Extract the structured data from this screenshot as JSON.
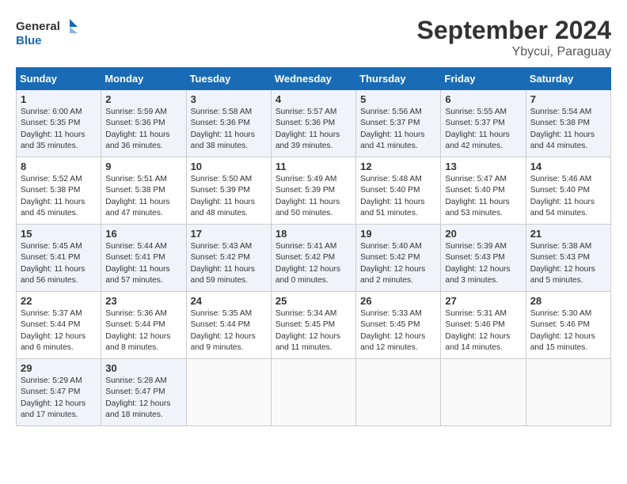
{
  "logo": {
    "line1": "General",
    "line2": "Blue"
  },
  "title": "September 2024",
  "subtitle": "Ybycui, Paraguay",
  "headers": [
    "Sunday",
    "Monday",
    "Tuesday",
    "Wednesday",
    "Thursday",
    "Friday",
    "Saturday"
  ],
  "weeks": [
    [
      {
        "num": "1",
        "info": "Sunrise: 6:00 AM\nSunset: 5:35 PM\nDaylight: 11 hours\nand 35 minutes."
      },
      {
        "num": "2",
        "info": "Sunrise: 5:59 AM\nSunset: 5:36 PM\nDaylight: 11 hours\nand 36 minutes."
      },
      {
        "num": "3",
        "info": "Sunrise: 5:58 AM\nSunset: 5:36 PM\nDaylight: 11 hours\nand 38 minutes."
      },
      {
        "num": "4",
        "info": "Sunrise: 5:57 AM\nSunset: 5:36 PM\nDaylight: 11 hours\nand 39 minutes."
      },
      {
        "num": "5",
        "info": "Sunrise: 5:56 AM\nSunset: 5:37 PM\nDaylight: 11 hours\nand 41 minutes."
      },
      {
        "num": "6",
        "info": "Sunrise: 5:55 AM\nSunset: 5:37 PM\nDaylight: 11 hours\nand 42 minutes."
      },
      {
        "num": "7",
        "info": "Sunrise: 5:54 AM\nSunset: 5:38 PM\nDaylight: 11 hours\nand 44 minutes."
      }
    ],
    [
      {
        "num": "8",
        "info": "Sunrise: 5:52 AM\nSunset: 5:38 PM\nDaylight: 11 hours\nand 45 minutes."
      },
      {
        "num": "9",
        "info": "Sunrise: 5:51 AM\nSunset: 5:38 PM\nDaylight: 11 hours\nand 47 minutes."
      },
      {
        "num": "10",
        "info": "Sunrise: 5:50 AM\nSunset: 5:39 PM\nDaylight: 11 hours\nand 48 minutes."
      },
      {
        "num": "11",
        "info": "Sunrise: 5:49 AM\nSunset: 5:39 PM\nDaylight: 11 hours\nand 50 minutes."
      },
      {
        "num": "12",
        "info": "Sunrise: 5:48 AM\nSunset: 5:40 PM\nDaylight: 11 hours\nand 51 minutes."
      },
      {
        "num": "13",
        "info": "Sunrise: 5:47 AM\nSunset: 5:40 PM\nDaylight: 11 hours\nand 53 minutes."
      },
      {
        "num": "14",
        "info": "Sunrise: 5:46 AM\nSunset: 5:40 PM\nDaylight: 11 hours\nand 54 minutes."
      }
    ],
    [
      {
        "num": "15",
        "info": "Sunrise: 5:45 AM\nSunset: 5:41 PM\nDaylight: 11 hours\nand 56 minutes."
      },
      {
        "num": "16",
        "info": "Sunrise: 5:44 AM\nSunset: 5:41 PM\nDaylight: 11 hours\nand 57 minutes."
      },
      {
        "num": "17",
        "info": "Sunrise: 5:43 AM\nSunset: 5:42 PM\nDaylight: 11 hours\nand 59 minutes."
      },
      {
        "num": "18",
        "info": "Sunrise: 5:41 AM\nSunset: 5:42 PM\nDaylight: 12 hours\nand 0 minutes."
      },
      {
        "num": "19",
        "info": "Sunrise: 5:40 AM\nSunset: 5:42 PM\nDaylight: 12 hours\nand 2 minutes."
      },
      {
        "num": "20",
        "info": "Sunrise: 5:39 AM\nSunset: 5:43 PM\nDaylight: 12 hours\nand 3 minutes."
      },
      {
        "num": "21",
        "info": "Sunrise: 5:38 AM\nSunset: 5:43 PM\nDaylight: 12 hours\nand 5 minutes."
      }
    ],
    [
      {
        "num": "22",
        "info": "Sunrise: 5:37 AM\nSunset: 5:44 PM\nDaylight: 12 hours\nand 6 minutes."
      },
      {
        "num": "23",
        "info": "Sunrise: 5:36 AM\nSunset: 5:44 PM\nDaylight: 12 hours\nand 8 minutes."
      },
      {
        "num": "24",
        "info": "Sunrise: 5:35 AM\nSunset: 5:44 PM\nDaylight: 12 hours\nand 9 minutes."
      },
      {
        "num": "25",
        "info": "Sunrise: 5:34 AM\nSunset: 5:45 PM\nDaylight: 12 hours\nand 11 minutes."
      },
      {
        "num": "26",
        "info": "Sunrise: 5:33 AM\nSunset: 5:45 PM\nDaylight: 12 hours\nand 12 minutes."
      },
      {
        "num": "27",
        "info": "Sunrise: 5:31 AM\nSunset: 5:46 PM\nDaylight: 12 hours\nand 14 minutes."
      },
      {
        "num": "28",
        "info": "Sunrise: 5:30 AM\nSunset: 5:46 PM\nDaylight: 12 hours\nand 15 minutes."
      }
    ],
    [
      {
        "num": "29",
        "info": "Sunrise: 5:29 AM\nSunset: 5:47 PM\nDaylight: 12 hours\nand 17 minutes."
      },
      {
        "num": "30",
        "info": "Sunrise: 5:28 AM\nSunset: 5:47 PM\nDaylight: 12 hours\nand 18 minutes."
      },
      {
        "num": "",
        "info": ""
      },
      {
        "num": "",
        "info": ""
      },
      {
        "num": "",
        "info": ""
      },
      {
        "num": "",
        "info": ""
      },
      {
        "num": "",
        "info": ""
      }
    ]
  ]
}
